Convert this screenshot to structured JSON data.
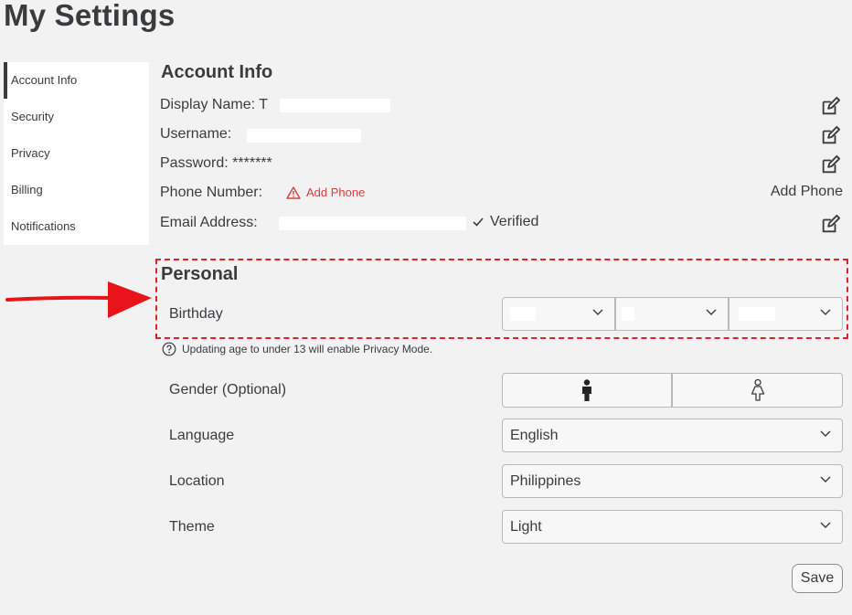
{
  "page": {
    "title": "My Settings"
  },
  "sidebar": {
    "items": [
      {
        "label": "Account Info",
        "active": true
      },
      {
        "label": "Security"
      },
      {
        "label": "Privacy"
      },
      {
        "label": "Billing"
      },
      {
        "label": "Notifications"
      }
    ]
  },
  "account": {
    "heading": "Account Info",
    "display_name_label": "Display Name:",
    "display_name_value": "T",
    "username_label": "Username:",
    "password_label": "Password:",
    "password_value": "*******",
    "phone_label": "Phone Number:",
    "add_phone_link": "Add Phone",
    "add_phone_right": "Add Phone",
    "email_label": "Email Address:",
    "email_status": "Verified"
  },
  "personal": {
    "heading": "Personal",
    "birthday_label": "Birthday",
    "birthday_hint": "Updating age to under 13 will enable Privacy Mode.",
    "gender_label": "Gender (Optional)",
    "language_label": "Language",
    "language_value": "English",
    "location_label": "Location",
    "location_value": "Philippines",
    "theme_label": "Theme",
    "theme_value": "Light"
  },
  "actions": {
    "save": "Save"
  },
  "colors": {
    "accent": "#393b3d",
    "highlight": "#e02424",
    "warning": "#d63f3f",
    "background": "#f2f2f3"
  }
}
